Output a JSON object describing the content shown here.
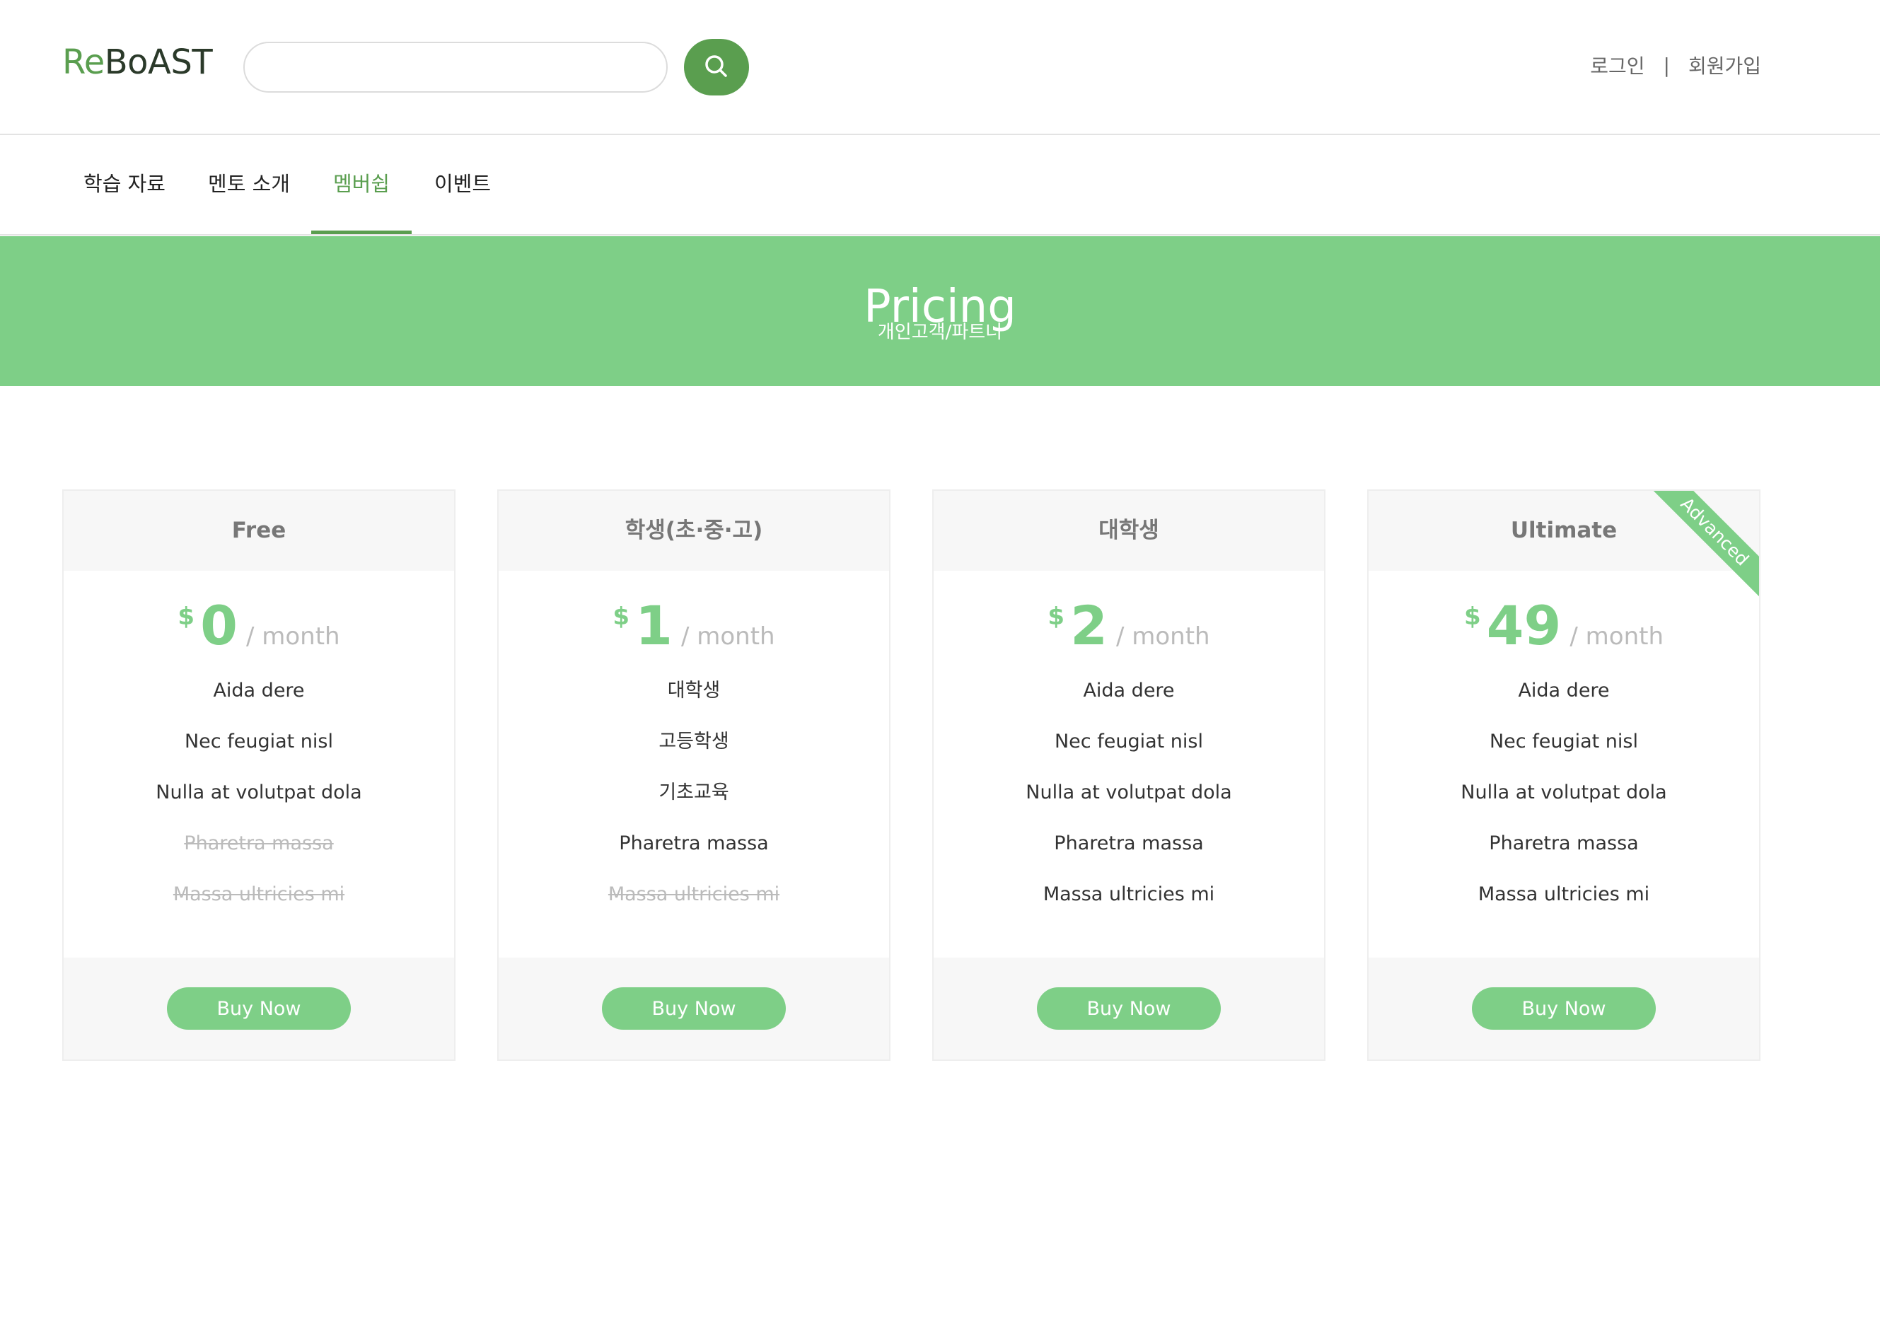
{
  "header": {
    "logo_a": "Re",
    "logo_b": "BoAST",
    "search_value": "",
    "login": "로그인",
    "separator": "|",
    "signup": "회원가입"
  },
  "nav": {
    "items": [
      {
        "label": "학습 자료"
      },
      {
        "label": "멘토 소개"
      },
      {
        "label": "멤버쉽",
        "active": true
      },
      {
        "label": "이벤트"
      }
    ]
  },
  "banner": {
    "title": "Pricing",
    "subtitle": "개인고객/파트너"
  },
  "plans": [
    {
      "name": "Free",
      "currency": "$",
      "amount": "0",
      "period": "/ month",
      "features": [
        {
          "text": "Aida dere",
          "available": true
        },
        {
          "text": "Nec feugiat nisl",
          "available": true
        },
        {
          "text": "Nulla at volutpat dola",
          "available": true
        },
        {
          "text": "Pharetra massa",
          "available": false
        },
        {
          "text": "Massa ultricies mi",
          "available": false
        }
      ],
      "button": "Buy Now"
    },
    {
      "name": "학생(초·중·고)",
      "currency": "$",
      "amount": "1",
      "period": "/ month",
      "features": [
        {
          "text": "대학생",
          "available": true
        },
        {
          "text": "고등학생",
          "available": true
        },
        {
          "text": "기초교육",
          "available": true
        },
        {
          "text": "Pharetra massa",
          "available": true
        },
        {
          "text": "Massa ultricies mi",
          "available": false
        }
      ],
      "button": "Buy Now"
    },
    {
      "name": "대학생",
      "currency": "$",
      "amount": "2",
      "period": "/ month",
      "features": [
        {
          "text": "Aida dere",
          "available": true
        },
        {
          "text": "Nec feugiat nisl",
          "available": true
        },
        {
          "text": "Nulla at volutpat dola",
          "available": true
        },
        {
          "text": "Pharetra massa",
          "available": true
        },
        {
          "text": "Massa ultricies mi",
          "available": true
        }
      ],
      "button": "Buy Now"
    },
    {
      "name": "Ultimate",
      "currency": "$",
      "amount": "49",
      "period": "/ month",
      "ribbon": "Advanced",
      "features": [
        {
          "text": "Aida dere",
          "available": true
        },
        {
          "text": "Nec feugiat nisl",
          "available": true
        },
        {
          "text": "Nulla at volutpat dola",
          "available": true
        },
        {
          "text": "Pharetra massa",
          "available": true
        },
        {
          "text": "Massa ultricies mi",
          "available": true
        }
      ],
      "button": "Buy Now"
    }
  ],
  "colors": {
    "brand": "#5a9e4f",
    "accent": "#7ecf87",
    "muted": "#bbbbbb"
  },
  "icons": {
    "search": "search-icon"
  }
}
